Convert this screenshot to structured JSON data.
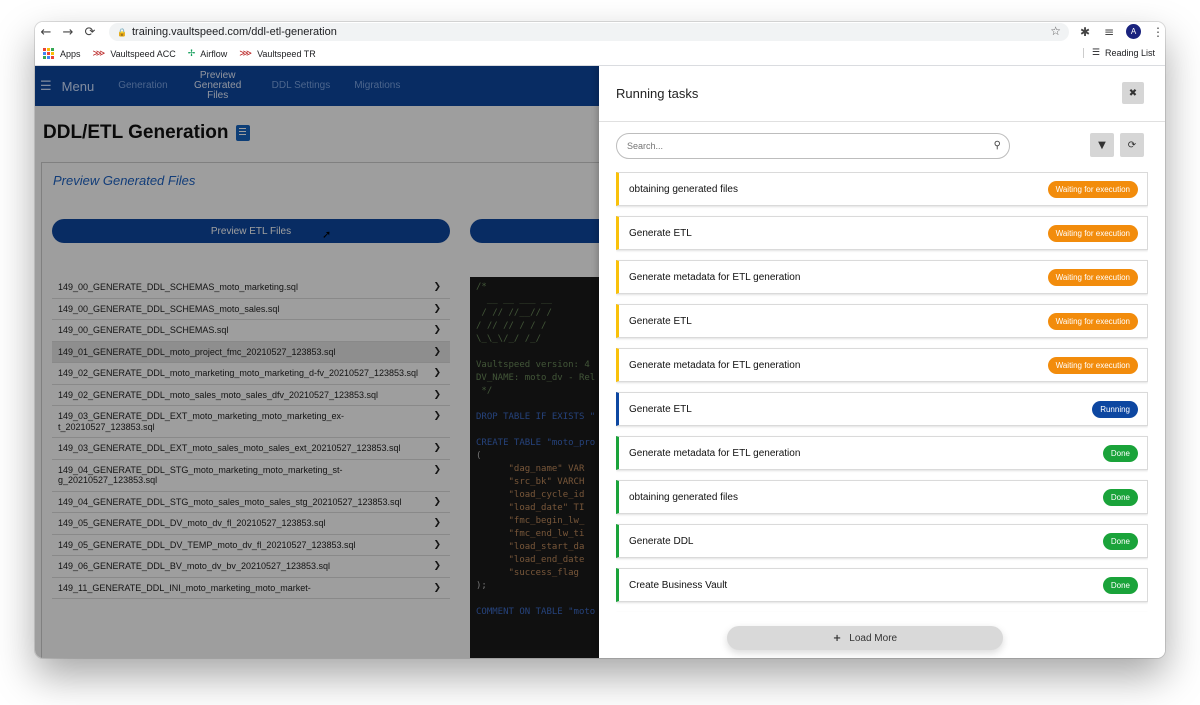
{
  "browser": {
    "url": "training.vaultspeed.com/ddl-etl-generation",
    "avatar_letter": "A",
    "bookmarks": [
      "Apps",
      "Vaultspeed ACC",
      "Airflow",
      "Vaultspeed TR"
    ],
    "reading_list": "Reading List"
  },
  "nav": {
    "menu_label": "Menu",
    "items": [
      "Generation",
      "Preview Generated Files",
      "DDL Settings",
      "Migrations"
    ]
  },
  "page": {
    "title": "DDL/ETL Generation",
    "panel_title": "Preview Generated Files",
    "preview_etl_label": "Preview ETL Files"
  },
  "files": [
    "149_00_GENERATE_DDL_SCHEMAS_moto_marketing.sql",
    "149_00_GENERATE_DDL_SCHEMAS_moto_sales.sql",
    "149_00_GENERATE_DDL_SCHEMAS.sql",
    "149_01_GENERATE_DDL_moto_project_fmc_20210527_123853.sql",
    "149_02_GENERATE_DDL_moto_marketing_moto_marketing_d-fv_20210527_123853.sql",
    "149_02_GENERATE_DDL_moto_sales_moto_sales_dfv_20210527_123853.sql",
    "149_03_GENERATE_DDL_EXT_moto_marketing_moto_marketing_ex-t_20210527_123853.sql",
    "149_03_GENERATE_DDL_EXT_moto_sales_moto_sales_ext_20210527_123853.sql",
    "149_04_GENERATE_DDL_STG_moto_marketing_moto_marketing_st-g_20210527_123853.sql",
    "149_04_GENERATE_DDL_STG_moto_sales_moto_sales_stg_20210527_123853.sql",
    "149_05_GENERATE_DDL_DV_moto_dv_fl_20210527_123853.sql",
    "149_05_GENERATE_DDL_DV_TEMP_moto_dv_fl_20210527_123853.sql",
    "149_06_GENERATE_DDL_BV_moto_dv_bv_20210527_123853.sql",
    "149_11_GENERATE_DDL_INI_moto_marketing_moto_market-"
  ],
  "selected_file_index": 3,
  "code_lines": [
    {
      "cls": "c",
      "text": "/*"
    },
    {
      "cls": "c",
      "text": "  __ __ ___ __"
    },
    {
      "cls": "c",
      "text": " / // //__// /"
    },
    {
      "cls": "c",
      "text": "/ // // / / /"
    },
    {
      "cls": "c",
      "text": "\\_\\_\\/_/ /_/"
    },
    {
      "cls": "w",
      "text": ""
    },
    {
      "cls": "c",
      "text": "Vaultspeed version: 4"
    },
    {
      "cls": "c",
      "text": "DV_NAME: moto_dv - Rel"
    },
    {
      "cls": "c",
      "text": " */"
    },
    {
      "cls": "w",
      "text": ""
    },
    {
      "cls": "k",
      "text": "DROP TABLE IF EXISTS \""
    },
    {
      "cls": "w",
      "text": ""
    },
    {
      "cls": "k",
      "text": "CREATE TABLE \"moto_pro"
    },
    {
      "cls": "w",
      "text": "("
    },
    {
      "cls": "s",
      "text": "      \"dag_name\" VAR"
    },
    {
      "cls": "s",
      "text": "      \"src_bk\" VARCH"
    },
    {
      "cls": "s",
      "text": "      \"load_cycle_id"
    },
    {
      "cls": "s",
      "text": "      \"load_date\" TI"
    },
    {
      "cls": "s",
      "text": "      \"fmc_begin_lw_"
    },
    {
      "cls": "s",
      "text": "      \"fmc_end_lw_ti"
    },
    {
      "cls": "s",
      "text": "      \"load_start_da"
    },
    {
      "cls": "s",
      "text": "      \"load_end_date"
    },
    {
      "cls": "s",
      "text": "      \"success_flag"
    },
    {
      "cls": "w",
      "text": ");"
    },
    {
      "cls": "w",
      "text": ""
    },
    {
      "cls": "k",
      "text": "COMMENT ON TABLE \"moto"
    }
  ],
  "drawer": {
    "title": "Running tasks",
    "search_placeholder": "Search...",
    "load_more_label": "Load More",
    "tasks": [
      {
        "name": "obtaining generated files",
        "status": "Waiting for execution",
        "kind": "waiting"
      },
      {
        "name": "Generate ETL",
        "status": "Waiting for execution",
        "kind": "waiting"
      },
      {
        "name": "Generate metadata for ETL generation",
        "status": "Waiting for execution",
        "kind": "waiting"
      },
      {
        "name": "Generate ETL",
        "status": "Waiting for execution",
        "kind": "waiting"
      },
      {
        "name": "Generate metadata for ETL generation",
        "status": "Waiting for execution",
        "kind": "waiting"
      },
      {
        "name": "Generate ETL",
        "status": "Running",
        "kind": "running"
      },
      {
        "name": "Generate metadata for ETL generation",
        "status": "Done",
        "kind": "done"
      },
      {
        "name": "obtaining generated files",
        "status": "Done",
        "kind": "done"
      },
      {
        "name": "Generate DDL",
        "status": "Done",
        "kind": "done"
      },
      {
        "name": "Create Business Vault",
        "status": "Done",
        "kind": "done"
      },
      {
        "name": "",
        "status": "",
        "kind": "done"
      }
    ]
  },
  "colors": {
    "nav_blue": "#0d47a1",
    "waiting": "#f28c0c",
    "running": "#0d47a1",
    "done": "#1aa33a"
  }
}
